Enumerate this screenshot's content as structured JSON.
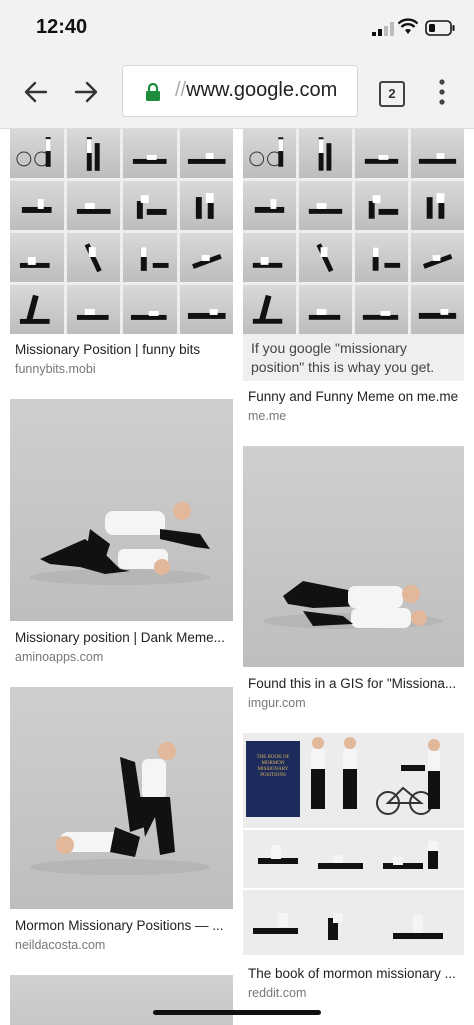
{
  "status": {
    "time": "12:40"
  },
  "browser": {
    "url_dim": "//",
    "url_host": "www.google.com",
    "tab_count": "2"
  },
  "results": [
    {
      "title": "Missionary Position | funny bits",
      "site": "funnybits.mobi"
    },
    {
      "title": "Funny and Funny Meme on me.me",
      "site": "me.me",
      "image_text": "If you google \"missionary position\" this is whay you get."
    },
    {
      "title": "Missionary position | Dank Meme...",
      "site": "aminoapps.com"
    },
    {
      "title": "Found this in a GIS for \"Missiona...",
      "site": "imgur.com"
    },
    {
      "title": "Mormon Missionary Positions — ...",
      "site": "neildacosta.com"
    },
    {
      "title": "The book of mormon missionary ...",
      "site": "reddit.com",
      "book_title": "THE BOOK OF MORMON MISSIONARY POSITIONS"
    }
  ],
  "icons": [
    "back-arrow-icon",
    "forward-arrow-icon",
    "lock-icon",
    "overflow-menu-icon",
    "signal-icon",
    "wifi-icon",
    "battery-icon"
  ]
}
